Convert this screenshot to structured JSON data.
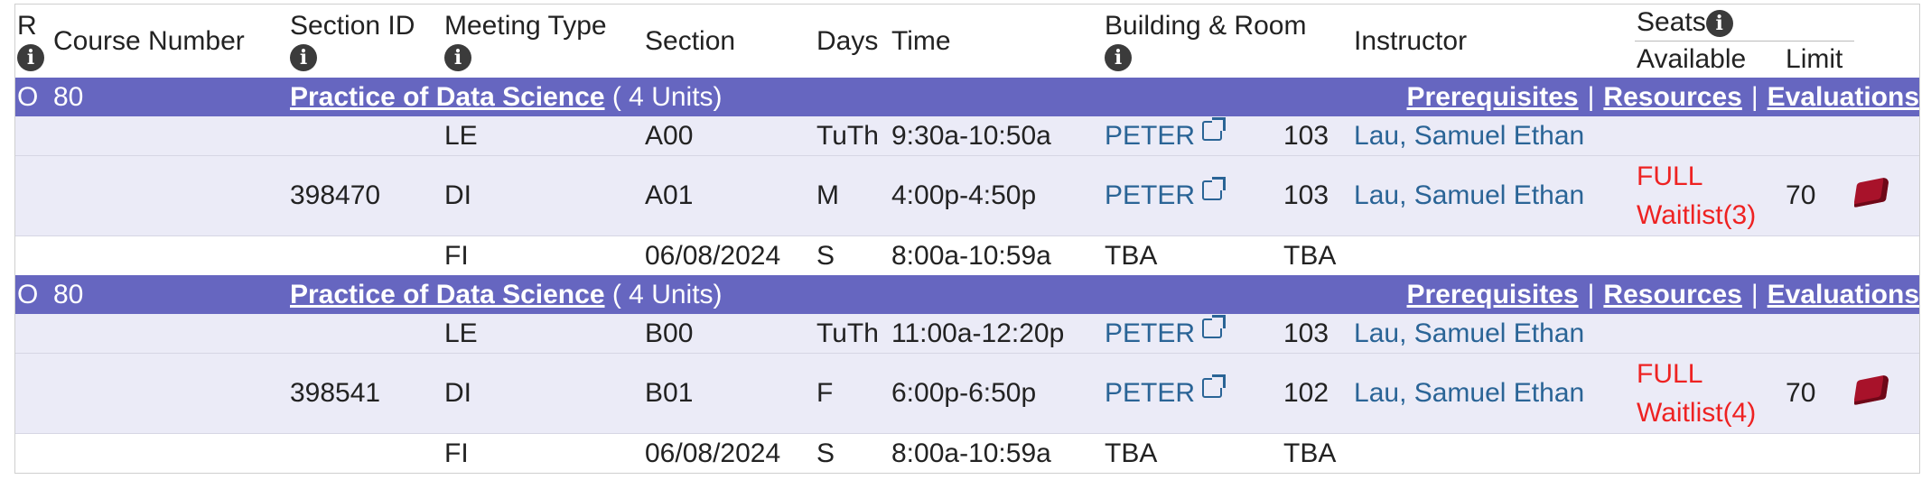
{
  "header": {
    "r": "R",
    "course_number": "Course Number",
    "section_id": "Section ID",
    "meeting_type": "Meeting Type",
    "section": "Section",
    "days": "Days",
    "time": "Time",
    "building_room": "Building & Room",
    "instructor": "Instructor",
    "seats": "Seats",
    "available": "Available",
    "limit": "Limit",
    "info_glyph": "i"
  },
  "courses": [
    {
      "r": "O",
      "number": "80",
      "title": "Practice of Data Science",
      "units": "( 4 Units)",
      "links": {
        "prerequisites": "Prerequisites",
        "resources": "Resources",
        "evaluations": "Evaluations"
      },
      "rows": [
        {
          "section_id": "",
          "type": "LE",
          "section": "A00",
          "days": "TuTh",
          "time": "9:30a-10:50a",
          "building": "PETER",
          "room": "103",
          "instructor": "Lau, Samuel Ethan"
        },
        {
          "section_id": "398470",
          "type": "DI",
          "section": "A01",
          "days": "M",
          "time": "4:00p-4:50p",
          "building": "PETER",
          "room": "103",
          "instructor": "Lau, Samuel Ethan",
          "available_1": "FULL",
          "available_2": "Waitlist(3)",
          "limit": "70"
        },
        {
          "section_id": "",
          "type": "FI",
          "section": "06/08/2024",
          "days": "S",
          "time": "8:00a-10:59a",
          "building": "TBA",
          "room": "TBA",
          "instructor": ""
        }
      ]
    },
    {
      "r": "O",
      "number": "80",
      "title": "Practice of Data Science",
      "units": "( 4 Units)",
      "links": {
        "prerequisites": "Prerequisites",
        "resources": "Resources",
        "evaluations": "Evaluations"
      },
      "rows": [
        {
          "section_id": "",
          "type": "LE",
          "section": "B00",
          "days": "TuTh",
          "time": "11:00a-12:20p",
          "building": "PETER",
          "room": "103",
          "instructor": "Lau, Samuel Ethan"
        },
        {
          "section_id": "398541",
          "type": "DI",
          "section": "B01",
          "days": "F",
          "time": "6:00p-6:50p",
          "building": "PETER",
          "room": "102",
          "instructor": "Lau, Samuel Ethan",
          "available_1": "FULL",
          "available_2": "Waitlist(4)",
          "limit": "70"
        },
        {
          "section_id": "",
          "type": "FI",
          "section": "06/08/2024",
          "days": "S",
          "time": "8:00a-10:59a",
          "building": "TBA",
          "room": "TBA",
          "instructor": ""
        }
      ]
    }
  ],
  "colors": {
    "course_bar": "#6666c0",
    "row_shade": "#ebebf7",
    "link_blue": "#2a6496",
    "full_red": "#e22222"
  },
  "icons": {
    "info": "info-icon",
    "external_link": "external-link-icon",
    "textbook": "textbook-icon"
  }
}
